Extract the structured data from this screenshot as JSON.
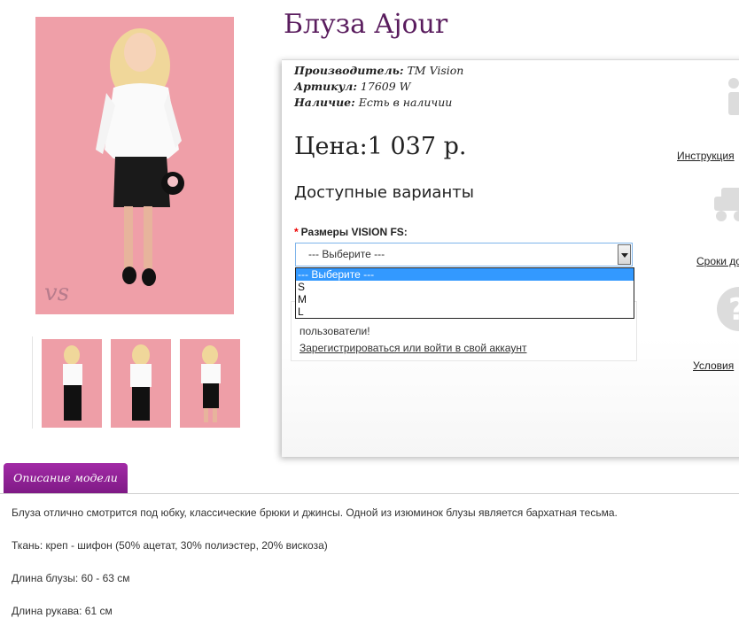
{
  "product": {
    "title": "Блуза Ajour",
    "manufacturer_label": "Производитель:",
    "manufacturer": "ТМ Vision",
    "sku_label": "Артикул:",
    "sku": "17609 W",
    "availability_label": "Наличие:",
    "availability": "Есть в наличии",
    "price": "Цена:1 037 р."
  },
  "options": {
    "heading": "Доступные варианты",
    "size_label": "Размеры VISION FS:",
    "required_mark": "*",
    "selected": "--- Выберите ---",
    "list": [
      "--- Выберите ---",
      "S",
      "M",
      "L"
    ]
  },
  "register": {
    "text": "пользователи!",
    "link": "Зарегистрироваться или войти в свой аккаунт"
  },
  "sidebar": {
    "instruction": "Инструкция",
    "delivery": "Сроки до",
    "terms": "Условия"
  },
  "description": {
    "tab": "Описание модели",
    "lines": [
      "Блуза отлично смотрится под юбку, классические брюки и джинсы. Одной из изюминок блузы является бархатная тесьма.",
      "Ткань: креп - шифон (50% ацетат, 30% полиэстер, 20% вискоза)",
      "Длина блузы: 60 - 63 см",
      "Длина рукава: 61 см"
    ]
  },
  "colors": {
    "accent": "#5a1d5e",
    "tab": "#8e1f94",
    "photo_bg": "#ef9fa8"
  }
}
